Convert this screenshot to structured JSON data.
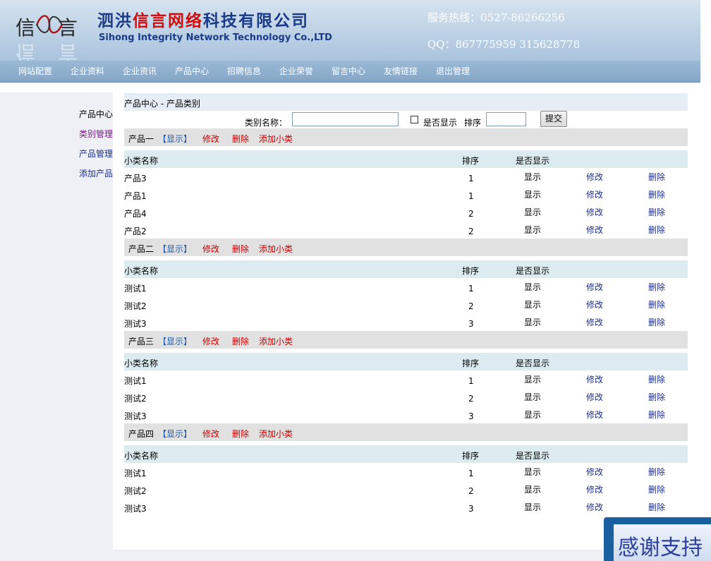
{
  "header": {
    "logo_chars": [
      "信",
      "言"
    ],
    "company_cn": [
      "泗洪",
      "信言",
      "网络",
      "科技有限公司"
    ],
    "company_en": "Sihong Integrity Network Technology Co.,LTD",
    "hotline": "服务热线：0527-86266256",
    "qq": "QQ：867775959  315628778"
  },
  "nav": [
    "网站配置",
    "企业资料",
    "企业资讯",
    "产品中心",
    "招聘信息",
    "企业荣誉",
    "留言中心",
    "友情链接",
    "退出管理"
  ],
  "sidebar": [
    "产品中心",
    "类别管理",
    "产品管理",
    "添加产品"
  ],
  "breadcrumb": "产品中心  - 产品类别",
  "form": {
    "category_label": "类别名称：",
    "category_value": "",
    "show_label": "是否显示",
    "sort_label": "排序",
    "sort_value": "",
    "submit": "提交"
  },
  "group_actions": {
    "show": "【显示】",
    "edit": "修改",
    "delete": "删除",
    "add_sub": "添加小类"
  },
  "columns": {
    "name": "小类名称",
    "sort": "排序",
    "show": "是否显示"
  },
  "row_actions": {
    "show": "显示",
    "edit": "修改",
    "delete": "删除"
  },
  "groups": [
    {
      "name": "产品一",
      "rows": [
        {
          "name": "产品3",
          "sort": "1"
        },
        {
          "name": "产品1",
          "sort": "1"
        },
        {
          "name": "产品4",
          "sort": "2"
        },
        {
          "name": "产品2",
          "sort": "2"
        }
      ]
    },
    {
      "name": "产品二",
      "rows": [
        {
          "name": "测试1",
          "sort": "1"
        },
        {
          "name": "测试2",
          "sort": "2"
        },
        {
          "name": "测试3",
          "sort": "3"
        }
      ]
    },
    {
      "name": "产品三",
      "rows": [
        {
          "name": "测试1",
          "sort": "1"
        },
        {
          "name": "测试2",
          "sort": "2"
        },
        {
          "name": "测试3",
          "sort": "3"
        }
      ]
    },
    {
      "name": "产品四",
      "rows": [
        {
          "name": "测试1",
          "sort": "1"
        },
        {
          "name": "测试2",
          "sort": "2"
        },
        {
          "name": "测试3",
          "sort": "3"
        }
      ]
    }
  ],
  "popup": "感谢支持",
  "colors": {
    "header_top": "#d6e3ef",
    "nav_bar": "#8fb0cf",
    "group_head": "#e1e1e1",
    "column_head": "#dcebf0",
    "action_red": "#cc0000",
    "action_link": "#1e2f8a"
  }
}
